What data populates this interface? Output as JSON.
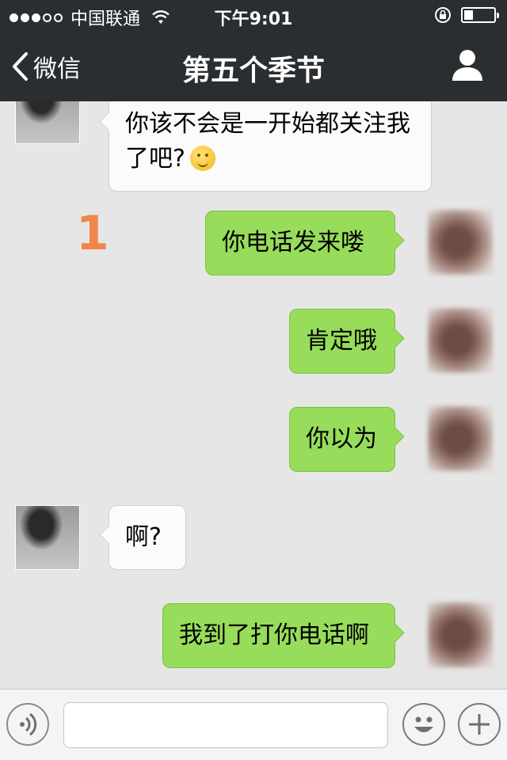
{
  "status_bar": {
    "carrier": "中国联通",
    "time": "下午9:01",
    "signal_bars": 3,
    "signal_total": 5,
    "battery_level": 0.3
  },
  "nav": {
    "back_label": "微信",
    "title": "第五个季节"
  },
  "annotation_marker": "1",
  "messages": [
    {
      "side": "in",
      "text": "你该不会是一开始都关注我了吧?",
      "emoji": "smirk-face-emoji"
    },
    {
      "side": "out",
      "text": "你电话发来喽"
    },
    {
      "side": "out",
      "text": "肯定哦"
    },
    {
      "side": "out",
      "text": "你以为"
    },
    {
      "side": "in",
      "text": "啊?"
    },
    {
      "side": "out",
      "text": "我到了打你电话啊"
    }
  ],
  "input_bar": {
    "placeholder": "",
    "value": ""
  },
  "colors": {
    "bar_bg": "#2a2e31",
    "chat_bg": "#e6e6e6",
    "out_bubble": "#97dc5a",
    "in_bubble": "#fbfbfb",
    "marker": "#f2864a"
  }
}
